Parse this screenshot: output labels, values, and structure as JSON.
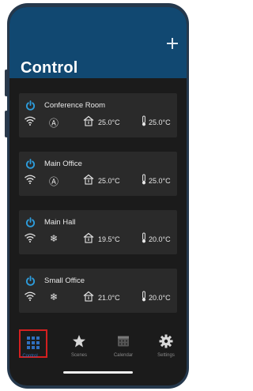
{
  "header": {
    "title": "Control"
  },
  "rooms": [
    {
      "name": "Conference Room",
      "mode": "auto",
      "mode_glyph": "Ⓐ",
      "indoor_temp": "25.0°C",
      "outdoor_temp": "25.0°C"
    },
    {
      "name": "Main Office",
      "mode": "auto",
      "mode_glyph": "Ⓐ",
      "indoor_temp": "25.0°C",
      "outdoor_temp": "25.0°C"
    },
    {
      "name": "Main Hall",
      "mode": "cool",
      "mode_glyph": "❄",
      "indoor_temp": "19.5°C",
      "outdoor_temp": "20.0°C"
    },
    {
      "name": "Small Office",
      "mode": "cool",
      "mode_glyph": "❄",
      "indoor_temp": "21.0°C",
      "outdoor_temp": "20.0°C"
    }
  ],
  "tabs": [
    {
      "label": "Control",
      "icon": "grid-icon",
      "selected": true
    },
    {
      "label": "Scenes",
      "icon": "star-icon",
      "selected": false
    },
    {
      "label": "Calendar",
      "icon": "calendar-icon",
      "selected": false
    },
    {
      "label": "Settings",
      "icon": "gear-icon",
      "selected": false
    }
  ],
  "colors": {
    "header": "#114871",
    "background": "#1b1b1b",
    "card": "#2a2a2a",
    "power_accent": "#2d9cdb",
    "selected_tab": "#2f6fbf",
    "selection_outline": "#d42020"
  }
}
